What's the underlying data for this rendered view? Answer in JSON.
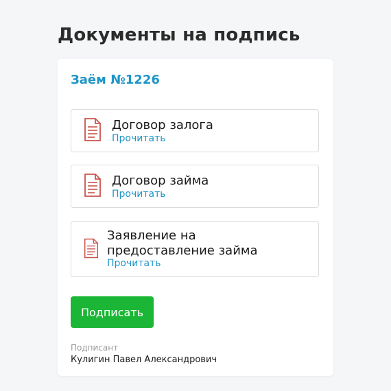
{
  "page": {
    "title": "Документы на подпись"
  },
  "loan": {
    "title": "Заём №1226"
  },
  "documents": [
    {
      "title_lines": [
        "Договор залога"
      ],
      "link": "Прочитать"
    },
    {
      "title_lines": [
        "Договор займа"
      ],
      "link": "Прочитать"
    },
    {
      "title_lines": [
        "Заявление на",
        "предоставление займа"
      ],
      "link": "Прочитать"
    }
  ],
  "actions": {
    "sign_label": "Подписать"
  },
  "signer": {
    "label": "Подписант",
    "name": "Кулигин Павел Александрович"
  },
  "colors": {
    "accent_blue": "#1e95c8",
    "sign_green": "#1bb635",
    "doc_icon_red": "#c9544b"
  }
}
